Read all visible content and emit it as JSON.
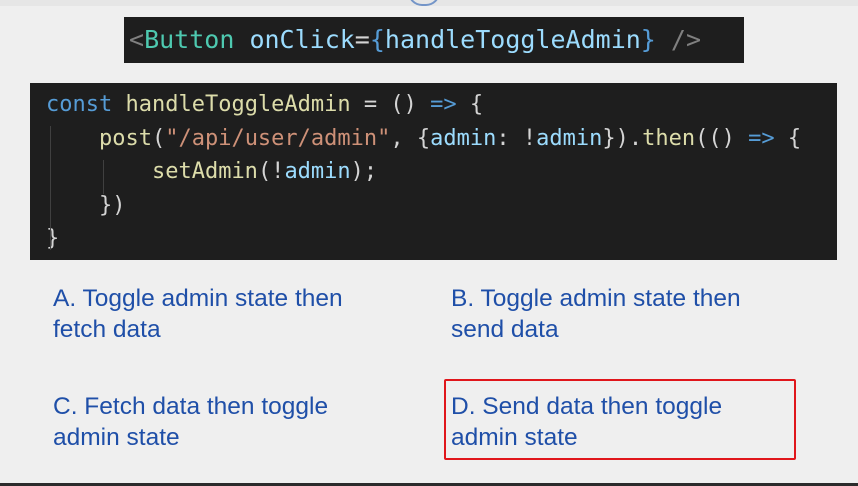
{
  "snippet": {
    "open": "<",
    "tag": "Button",
    "attr": "onClick",
    "eq": "=",
    "brace_open": "{",
    "handler": "handleToggleAdmin",
    "brace_close": "}",
    "close": " />"
  },
  "code": {
    "line1": {
      "kw": "const",
      "name": "handleToggleAdmin",
      "rest1": " = () ",
      "arrow": "=>",
      "rest2": " {"
    },
    "line2": {
      "fn": "post",
      "p1": "(",
      "str": "\"/api/user/admin\"",
      "p2": ", {",
      "key": "admin",
      "p3": ": !",
      "var": "admin",
      "p4": "}).",
      "then": "then",
      "p5": "(() ",
      "arrow": "=>",
      "p6": " {"
    },
    "line3": {
      "fn": "setAdmin",
      "p1": "(!",
      "var": "admin",
      "p2": ");"
    },
    "line4": "})",
    "line5": "}"
  },
  "options": {
    "a_line1": "A. Toggle admin state then",
    "a_line2": "fetch data",
    "b_line1": "B. Toggle admin state then",
    "b_line2": "send data",
    "c_line1": "C. Fetch data then toggle",
    "c_line2": "admin state",
    "d_line1": "D. Send data then toggle",
    "d_line2": "admin state"
  },
  "colors": {
    "answer_highlight": "#e0161b",
    "option_text": "#1f4fa8",
    "code_background": "#1e1e1e"
  }
}
